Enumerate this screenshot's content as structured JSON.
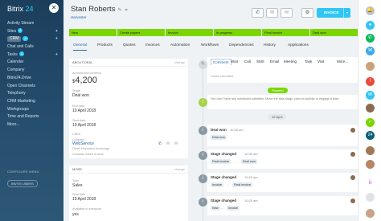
{
  "sidebar": {
    "logo_prefix": "Bitrix",
    "logo_suffix": "24",
    "items": [
      {
        "label": "Activity Stream",
        "count": ""
      },
      {
        "label": "Sites",
        "count": "2"
      },
      {
        "label": "CRM",
        "count": "4"
      },
      {
        "label": "Chat and Calls",
        "count": ""
      },
      {
        "label": "Tasks",
        "count": "2"
      },
      {
        "label": "Calendar",
        "count": ""
      },
      {
        "label": "Company",
        "count": ""
      },
      {
        "label": "Bitrix24.Drive",
        "count": ""
      },
      {
        "label": "Open Channels",
        "count": ""
      },
      {
        "label": "Telephony",
        "count": ""
      },
      {
        "label": "CRM Marketing",
        "count": ""
      },
      {
        "label": "Workgroups",
        "count": ""
      },
      {
        "label": "Time and Reports",
        "count": ""
      },
      {
        "label": "More...",
        "count": ""
      }
    ],
    "config_label": "CONFIGURE MENU",
    "invite_label": "INVITE USERS"
  },
  "header": {
    "title": "Stan Roberts",
    "subtitle": "Harvester",
    "invoice_label": "INVOICE"
  },
  "stages": [
    "New",
    "Create papers",
    "Invoice",
    "In progress",
    "Final invoice",
    "Deal won"
  ],
  "tabs": [
    "General",
    "Products",
    "Quotes",
    "Invoices",
    "Automation",
    "Workflows",
    "Dependencies",
    "History",
    "Applications"
  ],
  "about": {
    "header": "ABOUT DEAL",
    "change": "change",
    "amount_label": "Amount and currency",
    "amount_currency": "$",
    "amount_value": "4,200",
    "stage_label": "Stage",
    "stage_value": "Deal won",
    "end_date_label": "End date",
    "end_date_value": "19 April 2018",
    "start_date_label": "Start date",
    "start_date_value": "19 April 2018",
    "client_label": "Client",
    "company_label": "Company",
    "company_name": "WebService",
    "company_type": "Client, information technology",
    "contacts_hint": "Contacts linked to deal"
  },
  "more": {
    "header": "MORE",
    "change": "change",
    "type_label": "Type",
    "type_value": "Sales",
    "start_label": "Start date",
    "start_value": "19 April 2018",
    "avail_label": "Available to everyone",
    "avail_value": "yes"
  },
  "composer": {
    "tabs": [
      "Comment",
      "Wait",
      "Call",
      "SMS",
      "Email",
      "Meeting",
      "Task",
      "Visit",
      "More..."
    ],
    "placeholder": "Leave comment"
  },
  "timeline": {
    "planned_label": "Planned",
    "planned_text": "You don't have any scheduled activities. Move the deal stage, plan an activity or engage a lead.",
    "date_pill": "19 April",
    "events": [
      {
        "title": "Deal won",
        "time": "10:30 am",
        "from": "Deal won",
        "to": ""
      },
      {
        "title": "Stage changed",
        "time": "10:30 am",
        "from": "Final invoice",
        "to": "Deal won"
      },
      {
        "title": "Stage changed",
        "time": "10:29 am",
        "from": "Invoice",
        "to": "Final invoice"
      },
      {
        "title": "Stage changed",
        "time": "10:29 am",
        "from": "New",
        "to": "Invoice"
      }
    ]
  },
  "rightbar": {
    "badge_count": "24"
  },
  "colors": {
    "accent": "#2fc6f6",
    "stage_done": "#7bd500",
    "sidebar": "#1b3e5c",
    "link": "#2067b0"
  }
}
